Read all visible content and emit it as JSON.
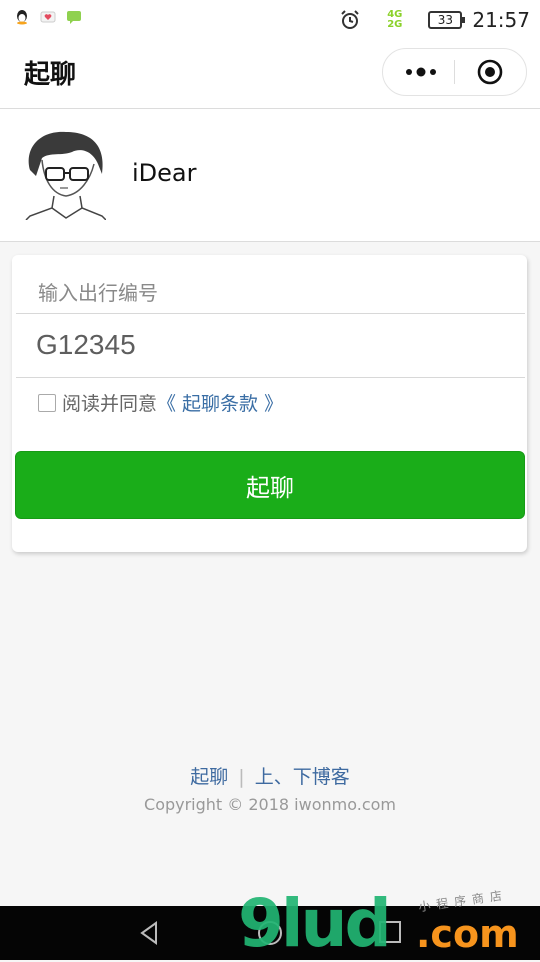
{
  "status_bar": {
    "notifications": [
      "qq-icon",
      "heart-mail-icon",
      "chat-icon"
    ],
    "network_top": "4G",
    "network_bottom": "2G",
    "battery": "33",
    "time": "21:57"
  },
  "navbar": {
    "title": "起聊"
  },
  "profile": {
    "username": "iDear"
  },
  "form": {
    "label": "输入出行编号",
    "code_value": "G12345",
    "agree_text": "阅读并同意",
    "terms_link": "《 起聊条款 》",
    "submit_label": "起聊"
  },
  "footer": {
    "link1": "起聊",
    "separator": "|",
    "link2": "上、下博客",
    "copyright": "Copyright © 2018 iwonmo.com"
  },
  "watermark": {
    "brand": "9lud",
    "suffix": ".com",
    "small": "小程序商店"
  },
  "colors": {
    "accent_green": "#1aad19",
    "link_blue": "#3e6aa0"
  }
}
